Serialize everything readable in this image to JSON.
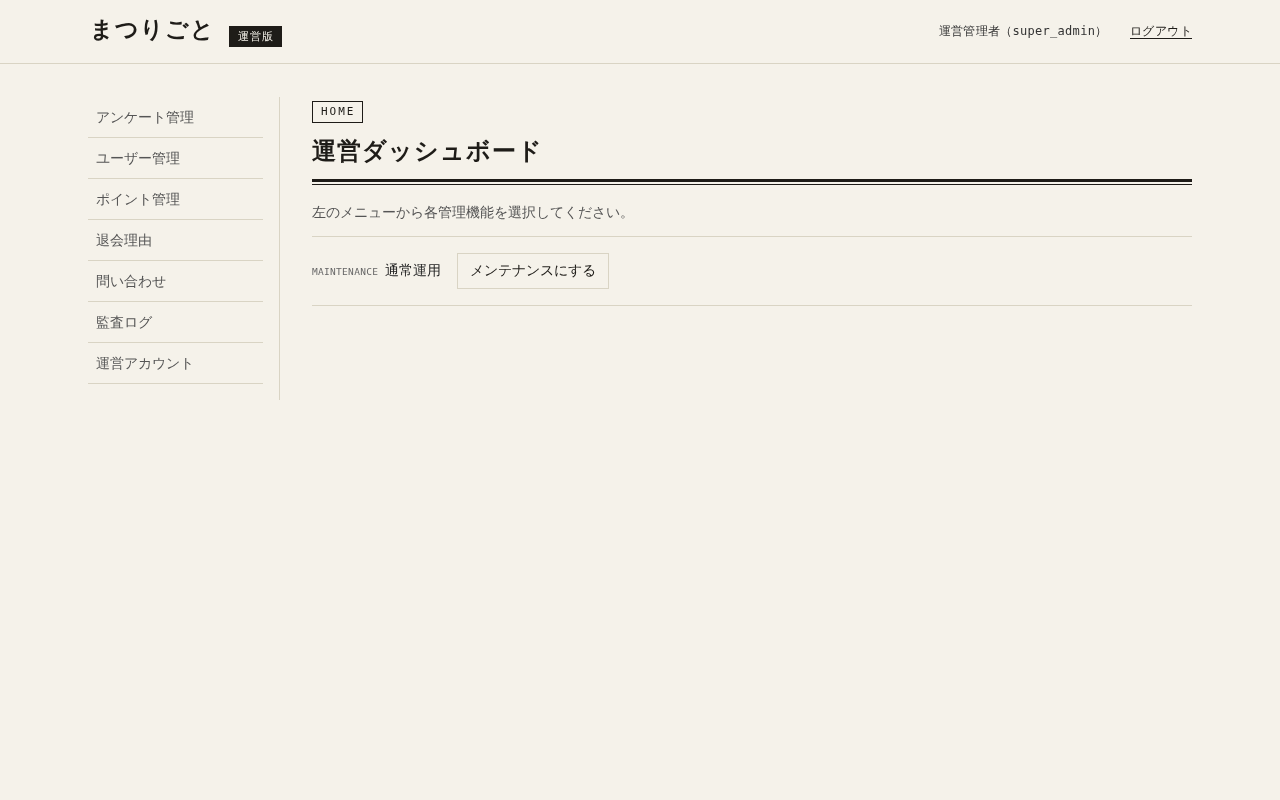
{
  "header": {
    "logo": "まつりごと",
    "badge": "運営版",
    "user": "運営管理者（super_admin）",
    "logout": "ログアウト"
  },
  "sidebar": {
    "items": [
      {
        "label": "アンケート管理",
        "selected": false
      },
      {
        "label": "ユーザー管理",
        "selected": false
      },
      {
        "label": "ポイント管理",
        "selected": false
      },
      {
        "label": "退会理由",
        "selected": false
      },
      {
        "label": "問い合わせ",
        "selected": false
      },
      {
        "label": "監査ログ",
        "selected": false
      },
      {
        "label": "運営アカウント",
        "selected": false
      }
    ]
  },
  "breadcrumb": "HOME",
  "title": "運営ダッシュボード",
  "description": "左のメニューから各管理機能を選択してください。",
  "maintenance": {
    "label": "MAINTENANCE",
    "status": "通常運用",
    "button": "メンテナンスにする"
  }
}
